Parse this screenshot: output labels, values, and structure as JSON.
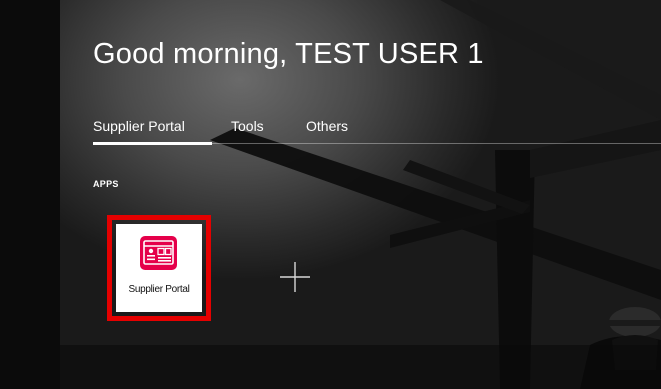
{
  "greeting": "Good morning, TEST USER 1",
  "tabs": [
    {
      "label": "Supplier Portal",
      "selected": true
    },
    {
      "label": "Tools",
      "selected": false
    },
    {
      "label": "Others",
      "selected": false
    }
  ],
  "apps_section": {
    "label": "APPS",
    "apps": [
      {
        "label": "Supplier Portal",
        "icon": "supplier-portal-icon",
        "highlighted": true
      }
    ],
    "add_icon": "plus-icon"
  },
  "colors": {
    "highlight_border": "#e50000",
    "app_icon_bg": "#e5004a",
    "text": "#ffffff"
  }
}
